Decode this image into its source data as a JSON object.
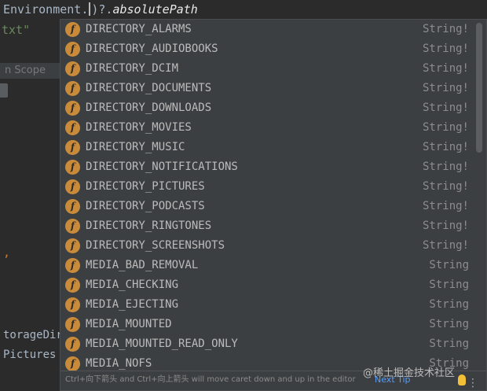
{
  "editor": {
    "line1_prefix": "Environment.",
    "line1_suffix": ")?.",
    "line1_member": "absolutePath",
    "line2": "txt\"",
    "hint": "n Scope",
    "line3": ",",
    "line4": "torageDir",
    "line5": "Pictures"
  },
  "completion": {
    "items": [
      {
        "name": "DIRECTORY_ALARMS",
        "type": "String!"
      },
      {
        "name": "DIRECTORY_AUDIOBOOKS",
        "type": "String!"
      },
      {
        "name": "DIRECTORY_DCIM",
        "type": "String!"
      },
      {
        "name": "DIRECTORY_DOCUMENTS",
        "type": "String!"
      },
      {
        "name": "DIRECTORY_DOWNLOADS",
        "type": "String!"
      },
      {
        "name": "DIRECTORY_MOVIES",
        "type": "String!"
      },
      {
        "name": "DIRECTORY_MUSIC",
        "type": "String!"
      },
      {
        "name": "DIRECTORY_NOTIFICATIONS",
        "type": "String!"
      },
      {
        "name": "DIRECTORY_PICTURES",
        "type": "String!"
      },
      {
        "name": "DIRECTORY_PODCASTS",
        "type": "String!"
      },
      {
        "name": "DIRECTORY_RINGTONES",
        "type": "String!"
      },
      {
        "name": "DIRECTORY_SCREENSHOTS",
        "type": "String!"
      },
      {
        "name": "MEDIA_BAD_REMOVAL",
        "type": "String"
      },
      {
        "name": "MEDIA_CHECKING",
        "type": "String"
      },
      {
        "name": "MEDIA_EJECTING",
        "type": "String"
      },
      {
        "name": "MEDIA_MOUNTED",
        "type": "String"
      },
      {
        "name": "MEDIA_MOUNTED_READ_ONLY",
        "type": "String"
      },
      {
        "name": "MEDIA_NOFS",
        "type": "String"
      }
    ],
    "icon_letter": "f",
    "icon_name": "field-icon",
    "footer_tip": "Ctrl+向下箭头 and Ctrl+向上箭头 will move caret down and up in the editor",
    "next_tip": "Next Tip",
    "watermark": "@稀土掘金技术社区",
    "colors": {
      "accent_link": "#589df6",
      "field_icon": "#c98a3a"
    }
  }
}
